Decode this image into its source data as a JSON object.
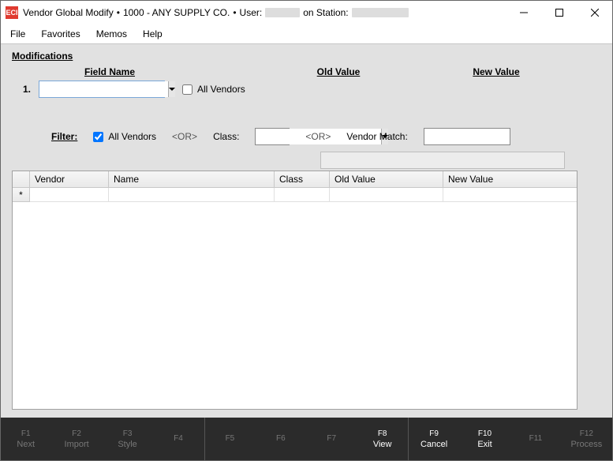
{
  "app_icon_text": "ECI",
  "title": {
    "app": "Vendor Global Modify",
    "sep": "•",
    "company": "1000 - ANY SUPPLY CO.",
    "user_label": "User:",
    "station_label": "on Station:"
  },
  "menu": {
    "file": "File",
    "favorites": "Favorites",
    "memos": "Memos",
    "help": "Help"
  },
  "section": {
    "modifications": "Modifications"
  },
  "headers": {
    "field_name": "Field Name",
    "old_value": "Old Value",
    "new_value": "New Value"
  },
  "row1": {
    "num": "1.",
    "field_value": "",
    "all_vendors": "All Vendors"
  },
  "filter": {
    "label": "Filter:",
    "all_vendors": "All Vendors",
    "all_vendors_checked": true,
    "or": "<OR>",
    "class_label": "Class:",
    "class_value": "",
    "vendor_match_label": "Vendor Match:",
    "vendor_match_value": ""
  },
  "grid": {
    "cols": {
      "vendor": "Vendor",
      "name": "Name",
      "class": "Class",
      "old": "Old Value",
      "new": "New Value"
    },
    "newrow_marker": "*"
  },
  "fkeys": [
    {
      "k": "F1",
      "label": "Next",
      "on": false
    },
    {
      "k": "F2",
      "label": "Import",
      "on": false
    },
    {
      "k": "F3",
      "label": "Style",
      "on": false
    },
    {
      "k": "F4",
      "label": "",
      "on": false
    },
    {
      "k": "F5",
      "label": "",
      "on": false,
      "sep": true
    },
    {
      "k": "F6",
      "label": "",
      "on": false
    },
    {
      "k": "F7",
      "label": "",
      "on": false
    },
    {
      "k": "F8",
      "label": "View",
      "on": true
    },
    {
      "k": "F9",
      "label": "Cancel",
      "on": true,
      "sep": true
    },
    {
      "k": "F10",
      "label": "Exit",
      "on": true
    },
    {
      "k": "F11",
      "label": "",
      "on": false
    },
    {
      "k": "F12",
      "label": "Process",
      "on": false
    }
  ]
}
